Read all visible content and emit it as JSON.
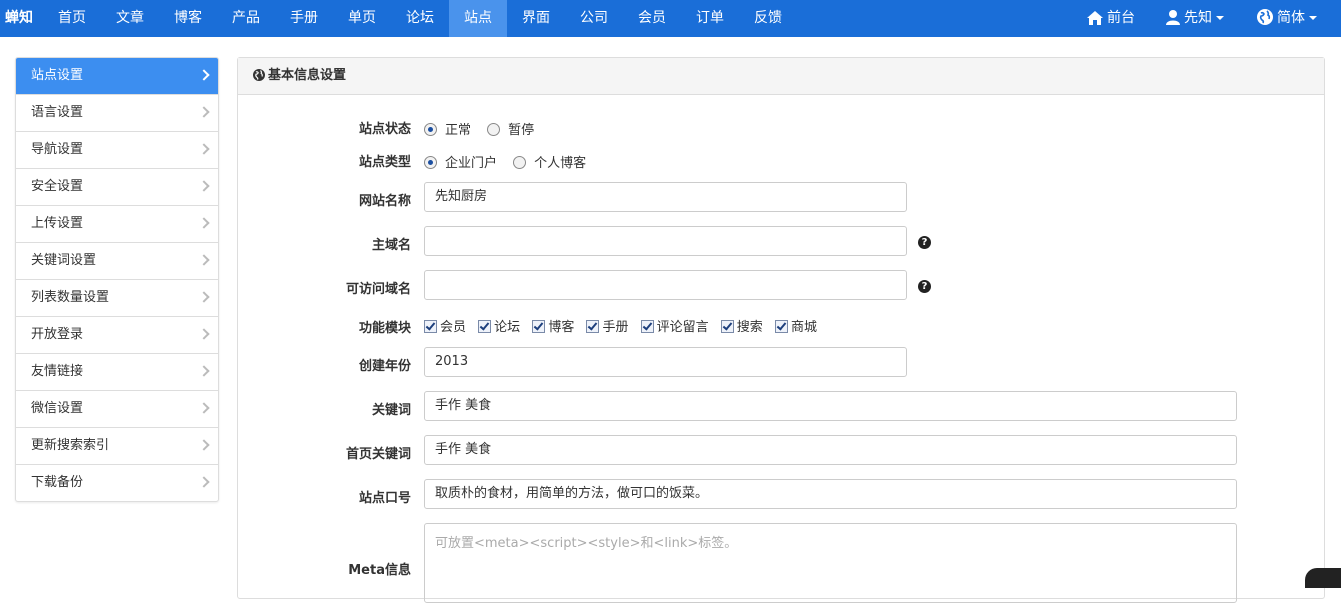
{
  "brand": "蝉知",
  "nav": [
    "首页",
    "文章",
    "博客",
    "产品",
    "手册",
    "单页",
    "论坛",
    "站点",
    "界面",
    "公司",
    "会员",
    "订单",
    "反馈"
  ],
  "nav_active": "站点",
  "right_nav": {
    "frontend": "前台",
    "user": "先知",
    "lang": "简体"
  },
  "sidebar": [
    "站点设置",
    "语言设置",
    "导航设置",
    "安全设置",
    "上传设置",
    "关键词设置",
    "列表数量设置",
    "开放登录",
    "友情链接",
    "微信设置",
    "更新搜索索引",
    "下载备份"
  ],
  "panel_title": "基本信息设置",
  "form": {
    "status_label": "站点状态",
    "status_options": [
      "正常",
      "暂停"
    ],
    "type_label": "站点类型",
    "type_options": [
      "企业门户",
      "个人博客"
    ],
    "name_label": "网站名称",
    "name_value": "先知厨房",
    "domain_label": "主域名",
    "domain_value": "",
    "alt_domain_label": "可访问域名",
    "alt_domain_value": "",
    "modules_label": "功能模块",
    "modules": [
      "会员",
      "论坛",
      "博客",
      "手册",
      "评论留言",
      "搜索",
      "商城"
    ],
    "year_label": "创建年份",
    "year_value": "2013",
    "keywords_label": "关键词",
    "keywords_value": "手作 美食",
    "home_keywords_label": "首页关键词",
    "home_keywords_value": "手作 美食",
    "slogan_label": "站点口号",
    "slogan_value": "取质朴的食材，用简单的方法，做可口的饭菜。",
    "meta_label": "Meta信息",
    "meta_placeholder": "可放置<meta><script><style>和<link>标签。"
  },
  "colors": {
    "topbar": "#1a6ed8",
    "active_nav": "#4a93ec",
    "active_sidebar": "#3c8ef0"
  },
  "icons": {
    "home": "home-icon",
    "user": "user-icon",
    "globe": "globe-icon",
    "help": "question-icon",
    "chevron": "chevron-right-icon"
  }
}
